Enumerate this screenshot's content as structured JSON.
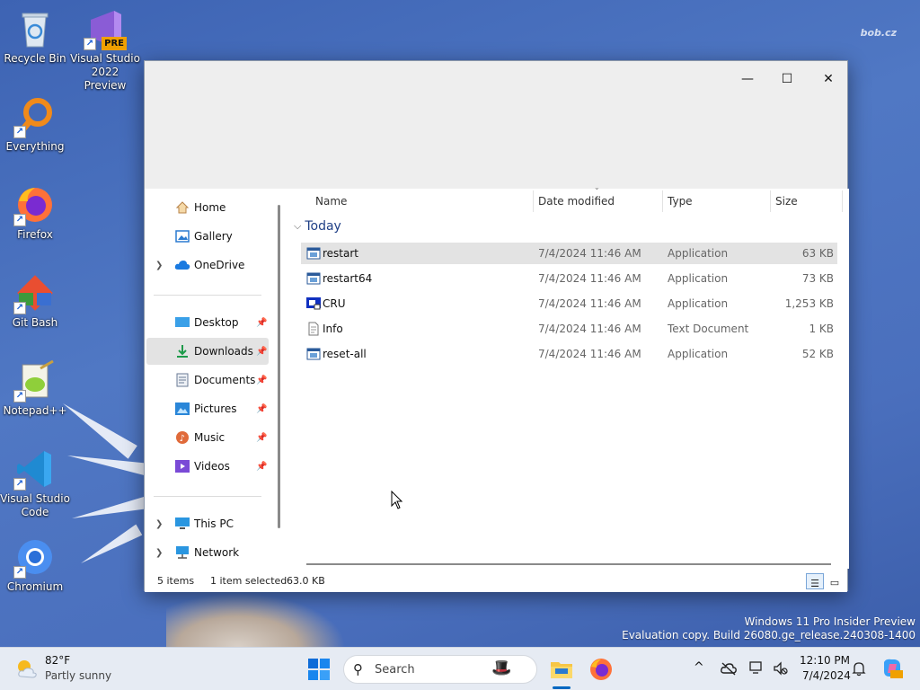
{
  "desktop": {
    "watermark": "bob.cz",
    "icons": [
      {
        "label": "Recycle Bin"
      },
      {
        "label": "Visual Studio 2022 Preview",
        "badge": "PRE"
      },
      {
        "label": "Everything"
      },
      {
        "label": "Firefox"
      },
      {
        "label": "Git Bash"
      },
      {
        "label": "Notepad++"
      },
      {
        "label": "Visual Studio Code"
      },
      {
        "label": "Chromium"
      }
    ],
    "eval_line1": "Windows 11 Pro Insider Preview",
    "eval_line2": "Evaluation copy. Build 26080.ge_release.240308-1400"
  },
  "window": {
    "controls": {
      "minimize": "—",
      "maximize": "☐",
      "close": "✕"
    },
    "nav": {
      "items": [
        {
          "label": "Home",
          "icon": "home-icon"
        },
        {
          "label": "Gallery",
          "icon": "gallery-icon"
        },
        {
          "label": "OneDrive",
          "icon": "cloud-icon",
          "expandable": true
        },
        {
          "label": "Desktop",
          "icon": "desktop-icon",
          "pinned": true
        },
        {
          "label": "Downloads",
          "icon": "download-icon",
          "pinned": true,
          "selected": true
        },
        {
          "label": "Documents",
          "icon": "document-icon",
          "pinned": true
        },
        {
          "label": "Pictures",
          "icon": "pictures-icon",
          "pinned": true
        },
        {
          "label": "Music",
          "icon": "music-icon",
          "pinned": true
        },
        {
          "label": "Videos",
          "icon": "videos-icon",
          "pinned": true
        },
        {
          "label": "This PC",
          "icon": "pc-icon",
          "expandable": true
        },
        {
          "label": "Network",
          "icon": "network-icon",
          "expandable": true
        }
      ]
    },
    "columns": {
      "name": "Name",
      "date": "Date modified",
      "type": "Type",
      "size": "Size"
    },
    "group_label": "Today",
    "files": [
      {
        "name": "restart",
        "date": "7/4/2024 11:46 AM",
        "type": "Application",
        "size": "63 KB",
        "selected": true,
        "icon": "app-icon"
      },
      {
        "name": "restart64",
        "date": "7/4/2024 11:46 AM",
        "type": "Application",
        "size": "73 KB",
        "icon": "app-icon"
      },
      {
        "name": "CRU",
        "date": "7/4/2024 11:46 AM",
        "type": "Application",
        "size": "1,253 KB",
        "icon": "cru-app-icon"
      },
      {
        "name": "Info",
        "date": "7/4/2024 11:46 AM",
        "type": "Text Document",
        "size": "1 KB",
        "icon": "text-file-icon"
      },
      {
        "name": "reset-all",
        "date": "7/4/2024 11:46 AM",
        "type": "Application",
        "size": "52 KB",
        "icon": "app-icon"
      }
    ],
    "status": {
      "count": "5 items",
      "selection": "1 item selected",
      "size": "63.0 KB"
    }
  },
  "taskbar": {
    "weather_temp": "82°F",
    "weather_desc": "Partly sunny",
    "search_placeholder": "Search",
    "time": "12:10 PM",
    "date": "7/4/2024",
    "tray_chevron": "^"
  },
  "colors": {
    "accent": "#0067c0",
    "selection": "#e3e3e3",
    "taskbar": "#e6ebf3"
  }
}
